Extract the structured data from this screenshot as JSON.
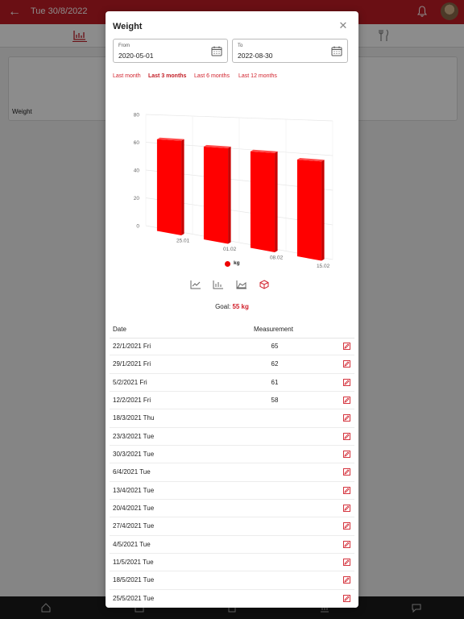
{
  "header": {
    "date": "Tue 30/8/2022"
  },
  "background_card": {
    "title": "Weight"
  },
  "modal": {
    "title": "Weight",
    "from": {
      "label": "From",
      "value": "2020-05-01"
    },
    "to": {
      "label": "To",
      "value": "2022-08-30"
    },
    "ranges": [
      "Last month",
      "Last 3 months",
      "Last 6 months",
      "Last 12 months"
    ],
    "active_range": "Last 3 months",
    "legend": "kg",
    "goal": {
      "label": "Goal:",
      "value": "55 kg"
    },
    "table": {
      "headers": [
        "Date",
        "Measurement"
      ],
      "rows": [
        {
          "date": "22/1/2021 Fri",
          "value": "65"
        },
        {
          "date": "29/1/2021 Fri",
          "value": "62"
        },
        {
          "date": "5/2/2021 Fri",
          "value": "61"
        },
        {
          "date": "12/2/2021 Fri",
          "value": "58"
        },
        {
          "date": "18/3/2021 Thu",
          "value": ""
        },
        {
          "date": "23/3/2021 Tue",
          "value": ""
        },
        {
          "date": "30/3/2021 Tue",
          "value": ""
        },
        {
          "date": "6/4/2021 Tue",
          "value": ""
        },
        {
          "date": "13/4/2021 Tue",
          "value": ""
        },
        {
          "date": "20/4/2021 Tue",
          "value": ""
        },
        {
          "date": "27/4/2021 Tue",
          "value": ""
        },
        {
          "date": "4/5/2021 Tue",
          "value": ""
        },
        {
          "date": "11/5/2021 Tue",
          "value": ""
        },
        {
          "date": "18/5/2021 Tue",
          "value": ""
        },
        {
          "date": "25/5/2021 Tue",
          "value": ""
        }
      ]
    }
  },
  "chart_data": {
    "type": "bar",
    "categories": [
      "25.01",
      "01.02",
      "08.02",
      "15.02"
    ],
    "values": [
      65,
      62,
      61,
      58
    ],
    "series": [
      {
        "name": "kg",
        "values": [
          65,
          62,
          61,
          58
        ]
      }
    ],
    "yticks": [
      0,
      20,
      40,
      60,
      80
    ],
    "ylim": [
      0,
      80
    ],
    "style": "3d",
    "grid": true,
    "legend": "bottom",
    "color": "#ff0000"
  },
  "colors": {
    "accent": "#c21d25",
    "link": "#d11f2a",
    "bar": "#ff0000"
  }
}
